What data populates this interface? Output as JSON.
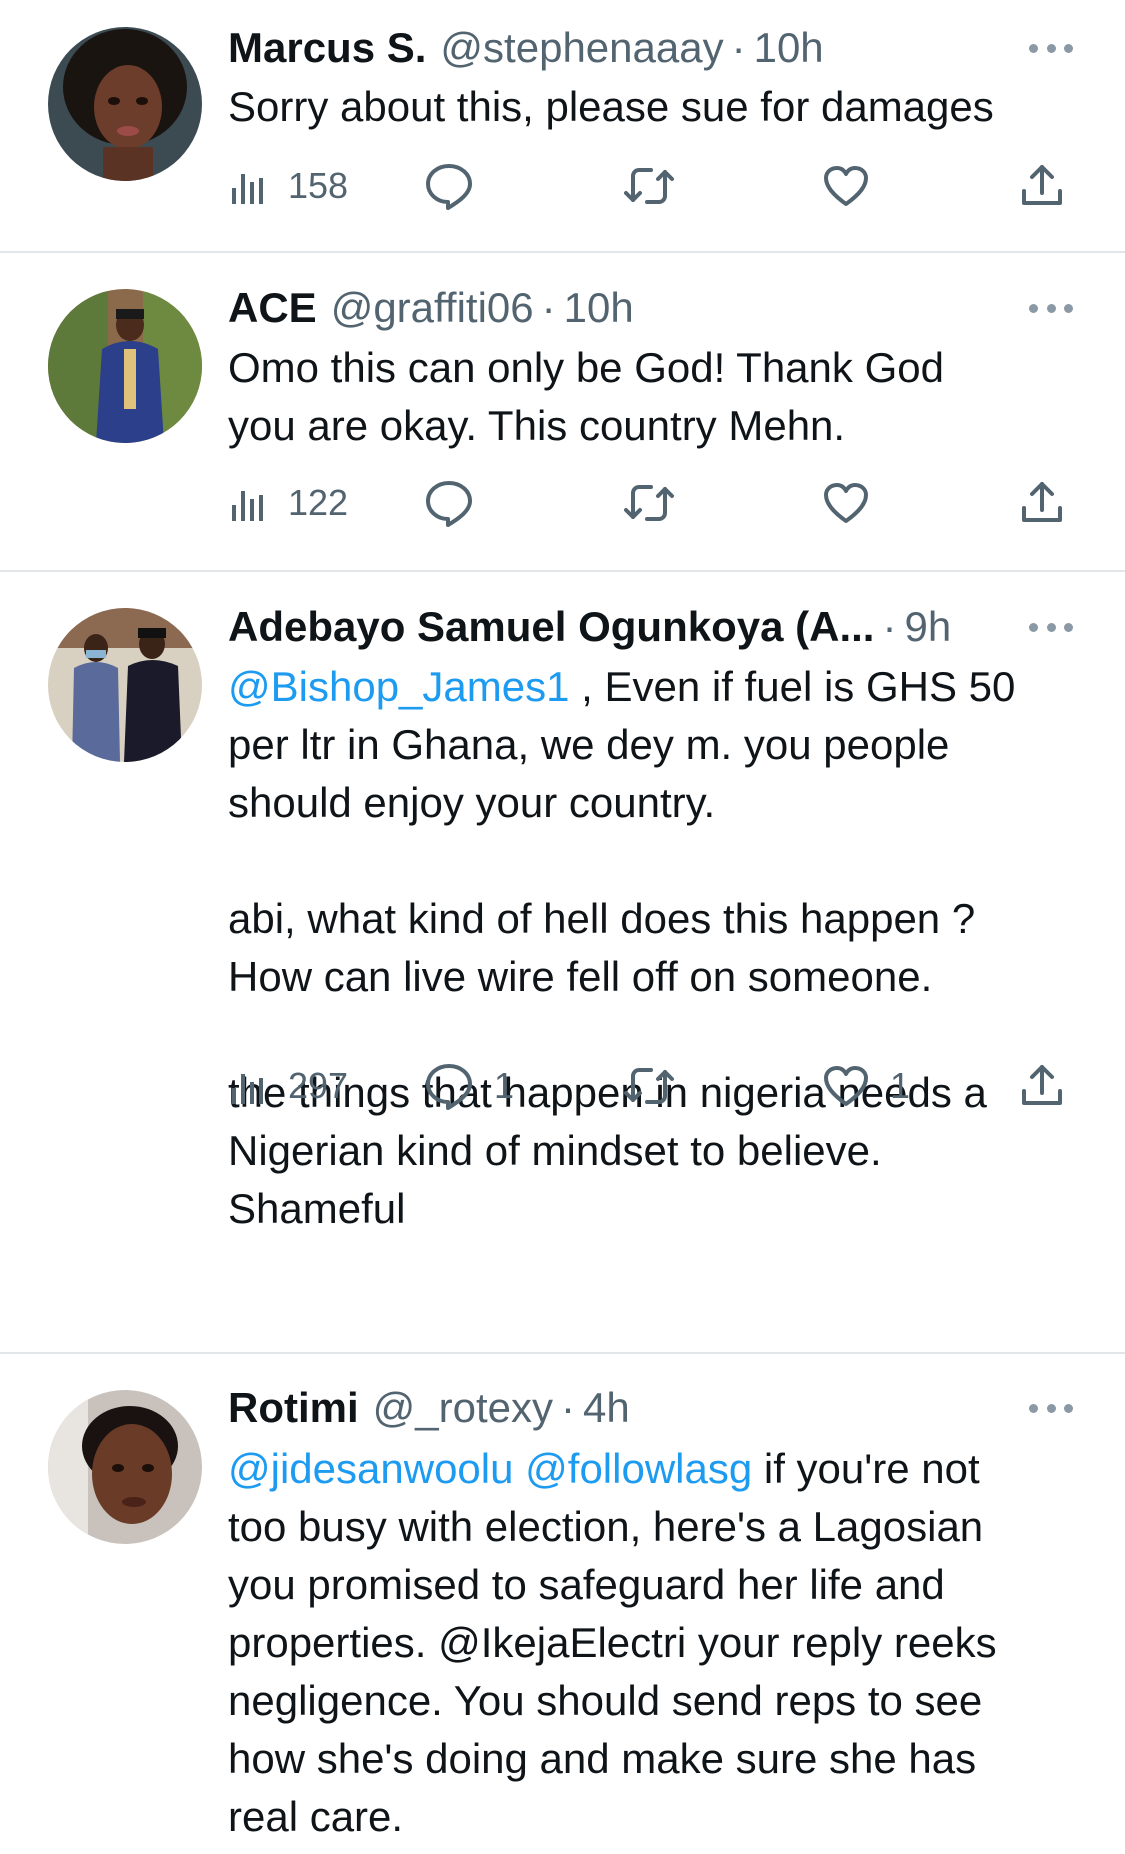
{
  "colors": {
    "text": "#0f1419",
    "secondary": "#536471",
    "mention": "#1d9bf0",
    "divider": "#e3e6e8",
    "icon": "#536471"
  },
  "tweets": [
    {
      "name": "Marcus S.",
      "handle": "@stephenaaay",
      "separator": "·",
      "time": "10h",
      "text_parts": [
        {
          "type": "text",
          "value": "Sorry about this, please sue for damages"
        }
      ],
      "views": "158",
      "replies": "",
      "retweets": "",
      "likes": "",
      "icons": {
        "views": "views-icon",
        "reply": "reply-icon",
        "retweet": "retweet-icon",
        "like": "like-icon",
        "share": "share-icon",
        "more": "more-icon"
      }
    },
    {
      "name": "ACE",
      "handle": "@graffiti06",
      "separator": "·",
      "time": "10h",
      "text_parts": [
        {
          "type": "text",
          "value": "Omo this can only be God! Thank God\nyou are okay. This country Mehn."
        }
      ],
      "views": "122",
      "replies": "",
      "retweets": "",
      "likes": ""
    },
    {
      "name": "Adebayo Samuel Ogunkoya (A...",
      "handle": "",
      "separator": "·",
      "time": "9h",
      "text_parts": [
        {
          "type": "mention",
          "value": "@Bishop_James1"
        },
        {
          "type": "text",
          "value": " , Even if fuel is GHS 50\nper ltr in Ghana, we dey m. you people\nshould enjoy your country.\n\nabi, what kind of hell does this happen ?\nHow can live wire fell off on someone.\n\nthe things that happen in nigeria needs a\nNigerian kind of mindset to believe.\nShameful"
        }
      ],
      "views": "297",
      "replies": "1",
      "retweets": "",
      "likes": "1"
    },
    {
      "name": "Rotimi",
      "handle": "@_rotexy",
      "separator": "·",
      "time": "4h",
      "text_parts": [
        {
          "type": "mention",
          "value": "@jidesanwoolu"
        },
        {
          "type": "text",
          "value": " "
        },
        {
          "type": "mention",
          "value": "@followlasg"
        },
        {
          "type": "text",
          "value": " if you're not\ntoo busy with election, here's a Lagosian\nyou promised to safeguard her life and\nproperties. @IkejaElectri your reply reeks\nnegligence. You should send reps to see\nhow she's doing and make sure she has\nreal care."
        }
      ]
    }
  ]
}
